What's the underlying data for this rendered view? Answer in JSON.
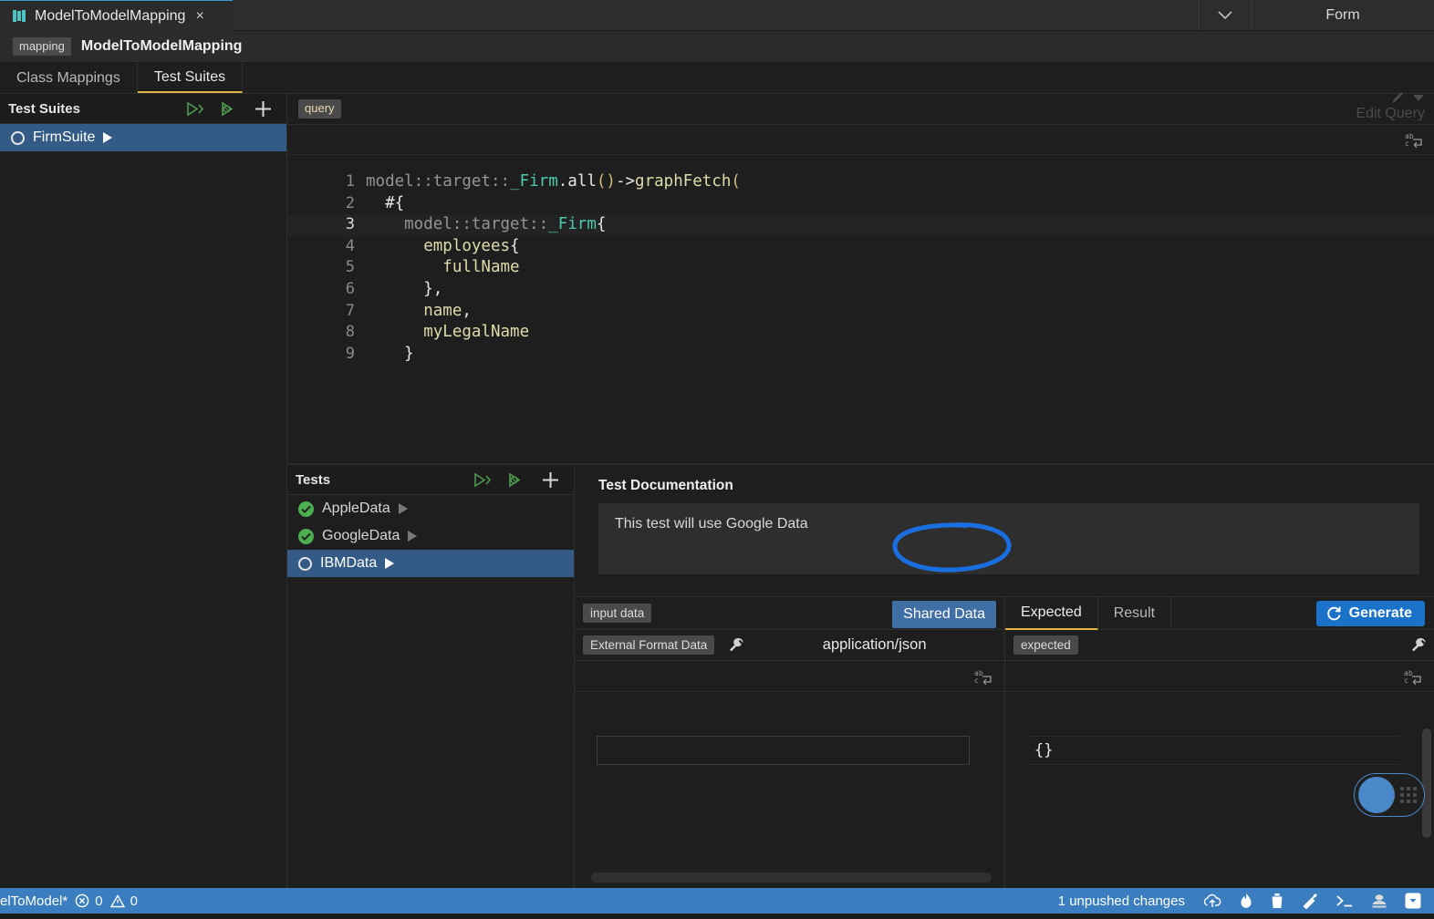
{
  "window": {
    "tab": {
      "title": "ModelToModelMapping",
      "icon": "book-icon",
      "close": "×"
    },
    "chevron": "chevron-down-icon",
    "form_label": "Form"
  },
  "breadcrumb": {
    "chip": "mapping",
    "title": "ModelToModelMapping"
  },
  "subtabs": [
    {
      "label": "Class Mappings",
      "active": false
    },
    {
      "label": "Test Suites",
      "active": true
    }
  ],
  "test_suites_panel": {
    "title": "Test Suites",
    "actions": [
      {
        "name": "run-all-icon",
        "label": "Run All"
      },
      {
        "name": "debug-run-icon",
        "label": "Run Failing"
      },
      {
        "name": "add-icon",
        "label": "+"
      }
    ],
    "items": [
      {
        "label": "FirmSuite",
        "status": "none",
        "selected": true
      }
    ]
  },
  "query_editor": {
    "tab_chip": "query",
    "edit_query_label": "Edit Query",
    "edit_query_icon": "pencil-icon",
    "wrap_icon": "word-wrap-icon",
    "active_line": 3,
    "lines": [
      {
        "num": "1",
        "tokens": [
          {
            "t": "model::target::",
            "c": "t-gray"
          },
          {
            "t": "_Firm",
            "c": "t-teal"
          },
          {
            "t": ".",
            "c": "t-punct"
          },
          {
            "t": "all",
            "c": "t-white"
          },
          {
            "t": "()",
            "c": "t-gold"
          },
          {
            "t": "->",
            "c": "t-white"
          },
          {
            "t": "graphFetch",
            "c": "t-prop"
          },
          {
            "t": "(",
            "c": "t-gold"
          }
        ]
      },
      {
        "num": "2",
        "tokens": [
          {
            "t": "  #{",
            "c": "t-white"
          }
        ]
      },
      {
        "num": "3",
        "tokens": [
          {
            "t": "    model::target::",
            "c": "t-gray"
          },
          {
            "t": "_Firm",
            "c": "t-teal"
          },
          {
            "t": "{",
            "c": "t-white"
          }
        ]
      },
      {
        "num": "4",
        "tokens": [
          {
            "t": "      employees",
            "c": "t-prop"
          },
          {
            "t": "{",
            "c": "t-white"
          }
        ]
      },
      {
        "num": "5",
        "tokens": [
          {
            "t": "        fullName",
            "c": "t-prop"
          }
        ]
      },
      {
        "num": "6",
        "tokens": [
          {
            "t": "      },",
            "c": "t-white"
          }
        ]
      },
      {
        "num": "7",
        "tokens": [
          {
            "t": "      name",
            "c": "t-prop"
          },
          {
            "t": ",",
            "c": "t-white"
          }
        ]
      },
      {
        "num": "8",
        "tokens": [
          {
            "t": "      myLegalName",
            "c": "t-prop"
          }
        ]
      },
      {
        "num": "9",
        "tokens": [
          {
            "t": "    }",
            "c": "t-white"
          }
        ]
      }
    ]
  },
  "tests_panel": {
    "title": "Tests",
    "actions": [
      {
        "name": "run-all-icon",
        "label": "Run All"
      },
      {
        "name": "debug-run-icon",
        "label": "Run Failing"
      },
      {
        "name": "add-icon",
        "label": "+"
      }
    ],
    "items": [
      {
        "label": "AppleData",
        "status": "passed",
        "selected": false
      },
      {
        "label": "GoogleData",
        "status": "passed",
        "selected": false
      },
      {
        "label": "IBMData",
        "status": "none",
        "selected": true
      }
    ]
  },
  "documentation": {
    "title": "Test Documentation",
    "text": "This test will use Google Data"
  },
  "input_pane": {
    "chip": "input data",
    "shared_data_label": "Shared Data",
    "format_chip": "External Format Data",
    "wrench_icon": "wrench-icon",
    "mime": "application/json",
    "wrap_icon": "word-wrap-icon",
    "value": ""
  },
  "expected_pane": {
    "tabs": [
      {
        "label": "Expected",
        "active": true
      },
      {
        "label": "Result",
        "active": false
      }
    ],
    "generate_label": "Generate",
    "generate_icon": "refresh-icon",
    "chip": "expected",
    "wrench_icon": "wrench-icon",
    "wrap_icon": "word-wrap-icon",
    "value": "{}"
  },
  "fab": {
    "name": "assistant-fab",
    "handle": "drag-handle-icon"
  },
  "statusbar": {
    "project": "elToModel*",
    "error_icon": "error-icon",
    "error_count": "0",
    "warning_icon": "warning-icon",
    "warning_count": "0",
    "changes": "1 unpushed changes",
    "icons": [
      {
        "name": "cloud-upload-icon"
      },
      {
        "name": "flame-icon"
      },
      {
        "name": "trash-icon"
      },
      {
        "name": "hammer-icon"
      },
      {
        "name": "terminal-icon"
      },
      {
        "name": "bug-icon"
      },
      {
        "name": "panel-toggle-icon"
      }
    ]
  },
  "colors": {
    "accent_blue": "#3a7ebf",
    "selection_blue": "#335b86",
    "tab_underline": "#e3b341",
    "annotation": "#1a6fe0",
    "generate_blue": "#1a73c8",
    "pass_green": "#4caf50"
  }
}
